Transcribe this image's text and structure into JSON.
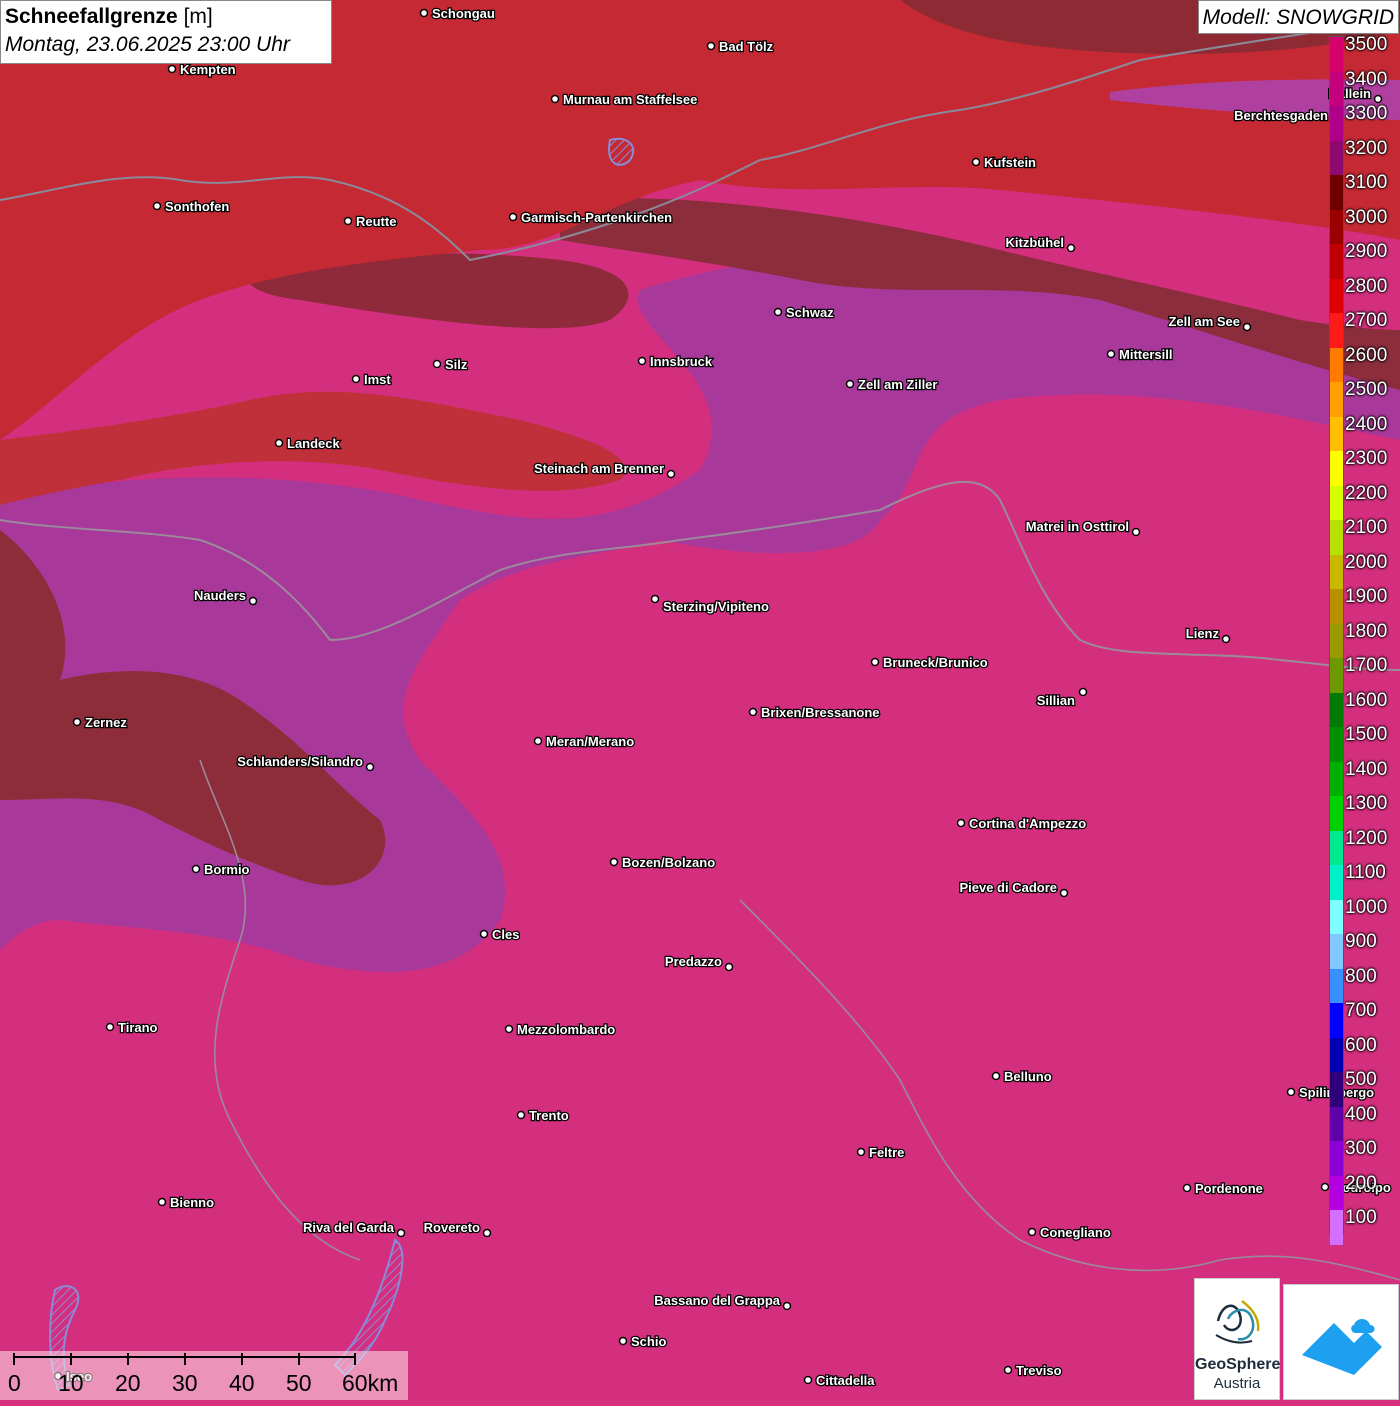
{
  "header": {
    "title_bold": "Schneefallgrenze",
    "title_unit": "[m]",
    "datetime": "Montag, 23.06.2025 23:00 Uhr",
    "model": "Modell: SNOWGRID"
  },
  "legend": {
    "levels": [
      "3500",
      "3400",
      "3300",
      "3200",
      "3100",
      "3000",
      "2900",
      "2800",
      "2700",
      "2600",
      "2500",
      "2400",
      "2300",
      "2200",
      "2100",
      "2000",
      "1900",
      "1800",
      "1700",
      "1600",
      "1500",
      "1400",
      "1300",
      "1200",
      "1100",
      "1000",
      "900",
      "800",
      "700",
      "600",
      "500",
      "400",
      "300",
      "200",
      "100"
    ],
    "colors": [
      "#d8006a",
      "#c4007c",
      "#b0008a",
      "#8e0a6e",
      "#6e0000",
      "#9a0000",
      "#c00000",
      "#e00000",
      "#ff1a1a",
      "#ff7b00",
      "#ff9f00",
      "#ffbf00",
      "#ffff00",
      "#d6ff00",
      "#b8e000",
      "#c8b800",
      "#b89000",
      "#9a9a00",
      "#6a9a00",
      "#007a00",
      "#009000",
      "#00b000",
      "#00d000",
      "#00e890",
      "#00f0c8",
      "#80ffff",
      "#80c8ff",
      "#3890ff",
      "#0000ff",
      "#0000b0",
      "#30007a",
      "#6000a8",
      "#8c00d8",
      "#b400e0",
      "#d470ff"
    ]
  },
  "cities": [
    {
      "name": "Schongau"
    },
    {
      "name": "Bad Tölz"
    },
    {
      "name": "Kempten"
    },
    {
      "name": "Murnau am Staffelsee"
    },
    {
      "name": "Hallein"
    },
    {
      "name": "Berchtesgaden"
    },
    {
      "name": "Kufstein"
    },
    {
      "name": "Sonthofen"
    },
    {
      "name": "Reutte"
    },
    {
      "name": "Garmisch-Partenkirchen"
    },
    {
      "name": "Kitzbühel"
    },
    {
      "name": "Schwaz"
    },
    {
      "name": "Zell am See"
    },
    {
      "name": "Mittersill"
    },
    {
      "name": "Innsbruck"
    },
    {
      "name": "Silz"
    },
    {
      "name": "Imst"
    },
    {
      "name": "Zell am Ziller"
    },
    {
      "name": "Landeck"
    },
    {
      "name": "Steinach am Brenner"
    },
    {
      "name": "Matrei in Osttirol"
    },
    {
      "name": "Nauders"
    },
    {
      "name": "Sterzing/Vipiteno"
    },
    {
      "name": "Lienz"
    },
    {
      "name": "Bruneck/Brunico"
    },
    {
      "name": "Sillian"
    },
    {
      "name": "Zernez"
    },
    {
      "name": "Brixen/Bressanone"
    },
    {
      "name": "Meran/Merano"
    },
    {
      "name": "Schlanders/Silandro"
    },
    {
      "name": "Cortina d'Ampezzo"
    },
    {
      "name": "Bozen/Bolzano"
    },
    {
      "name": "Bormio"
    },
    {
      "name": "Pieve di Cadore"
    },
    {
      "name": "Cles"
    },
    {
      "name": "Predazzo"
    },
    {
      "name": "Tirano"
    },
    {
      "name": "Mezzolombardo"
    },
    {
      "name": "Belluno"
    },
    {
      "name": "Spilimbergo"
    },
    {
      "name": "Trento"
    },
    {
      "name": "Feltre"
    },
    {
      "name": "Pordenone"
    },
    {
      "name": "Codroipo"
    },
    {
      "name": "Bienno"
    },
    {
      "name": "Riva del Garda"
    },
    {
      "name": "Rovereto"
    },
    {
      "name": "Conegliano"
    },
    {
      "name": "Bassano del Grappa"
    },
    {
      "name": "Schio"
    },
    {
      "name": "Treviso"
    },
    {
      "name": "Cittadella"
    },
    {
      "name": "Iseo"
    }
  ],
  "scalebar": {
    "ticks": [
      "0",
      "10",
      "20",
      "30",
      "40",
      "50",
      "60km"
    ]
  },
  "logos": {
    "geosphere_line1": "GeoSphere",
    "geosphere_line2": "Austria"
  }
}
